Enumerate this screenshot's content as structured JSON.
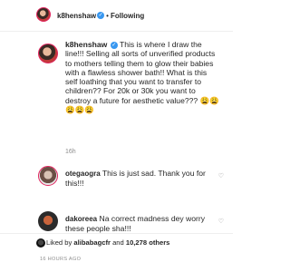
{
  "header": {
    "username": "k8henshaw",
    "separator": "•",
    "follow_label": "Following"
  },
  "caption": {
    "username": "k8henshaw",
    "text": "This is where I draw the line!!! Selling all sorts of unverified products to mothers telling them to glow their babies with a flawless shower bath!! What is this self loathing that you want to transfer to children?? For 20k or 30k you want to destroy a future for aesthetic value??? 😩😩😩😩😩",
    "time": "16h"
  },
  "comments": [
    {
      "username": "otegaogra",
      "text": "This is just sad. Thank you for this!!!",
      "time": "16h",
      "likes": "1 like",
      "reply": "Reply"
    },
    {
      "username": "dakoreea",
      "text": "Na correct madness dey worry these people sha!!!",
      "time": "16h",
      "likes": "1 like",
      "reply": "Reply"
    }
  ],
  "likes": {
    "prefix": "Liked by",
    "user": "alibabagcfr",
    "conj": "and",
    "count": "10,278 others"
  },
  "post_time": "16 HOURS AGO",
  "icons": {
    "verified": "verified-badge-icon",
    "heart": "heart-icon"
  },
  "colors": {
    "verified": "#3897f0",
    "story_ring": "#e0245e",
    "secondary_text": "#8e8e8e"
  }
}
